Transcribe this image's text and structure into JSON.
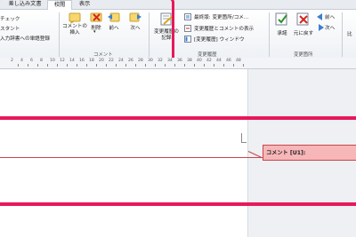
{
  "tabs": [
    {
      "label": "差し込み文書"
    },
    {
      "label": "校閲"
    },
    {
      "label": "表示"
    }
  ],
  "ribbon": {
    "proofing": {
      "spellcheck": "チェック",
      "assistant": "スタント",
      "dictionary": "入力辞書への単語登録"
    },
    "comments": {
      "new_comment": "コメントの\n挿入",
      "delete": "削除",
      "previous": "前へ",
      "next": "次へ",
      "group_label": "コメント"
    },
    "tracking": {
      "track_changes": "変更履歴の\n記録",
      "display_final": "最終版: 変更箇所/コメ...",
      "show_markup": "変更履歴とコメントの表示",
      "reviewing_pane": "[変更履歴] ウィンドウ",
      "group_label": "変更履歴"
    },
    "changes": {
      "accept": "承諾",
      "reject": "元に戻す",
      "previous": "前へ",
      "next": "次へ",
      "group_label": "変更箇所"
    },
    "compare": "比"
  },
  "ruler": {
    "numbers": [
      "2",
      "4",
      "6",
      "8",
      "10",
      "12",
      "14",
      "16",
      "18",
      "20",
      "22",
      "24",
      "26",
      "28",
      "30",
      "32",
      "34",
      "36",
      "38",
      "40",
      "42",
      "44",
      "46",
      "48"
    ]
  },
  "comment": {
    "label": "コメント [U1]:"
  },
  "colors": {
    "highlight": "#e8185a",
    "comment_fill": "#f7b6b8",
    "comment_border": "#c8464c"
  }
}
